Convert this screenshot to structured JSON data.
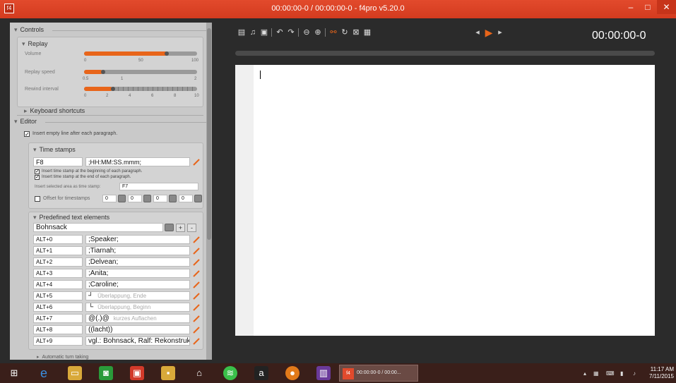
{
  "window": {
    "title": "00:00:00-0 / 00:00:00-0 - f4pro v5.20.0",
    "app_icon": "f4-icon",
    "controls": {
      "minimize": "–",
      "maximize": "□",
      "close": "✕"
    }
  },
  "colors": {
    "accent": "#e8651a",
    "titlebar": "#d43b1f",
    "panel": "#c9c9c9"
  },
  "controls_section": {
    "title": "Controls",
    "replay": {
      "title": "Replay",
      "volume_label": "Volume",
      "volume_ticks": [
        "0",
        "50",
        "100"
      ],
      "volume_value": 75,
      "speed_label": "Replay speed",
      "speed_ticks": [
        "0.5",
        "1",
        "2"
      ],
      "speed_value": 0.75,
      "rewind_label": "Rewind interval",
      "rewind_ticks": [
        "0",
        "2",
        "4",
        "6",
        "8",
        "10"
      ],
      "rewind_value": 3
    },
    "keyboard_shortcuts": "Keyboard shortcuts"
  },
  "editor_section": {
    "title": "Editor",
    "insert_empty_line": "Insert empty line after each paragraph.",
    "timestamps": {
      "title": "Time stamps",
      "key": "F8",
      "format": ";HH:MM:SS.mmm;",
      "opt_begin": "Insert time stamp at the beginning of each paragraph.",
      "opt_end": "Insert time stamp at the end of each paragraph.",
      "selected_area_label": "Insert selected area as time stamp:",
      "selected_area_key": "F7",
      "offset_label": "Offset for timestamps",
      "offset_values": [
        "0",
        "0",
        "0",
        "0"
      ]
    },
    "predefined": {
      "title": "Predefined text elements",
      "preset": "Bohnsack",
      "add": "+",
      "remove": "-",
      "rows": [
        {
          "key": "ALT+0",
          "text": ";Speaker;"
        },
        {
          "key": "ALT+1",
          "text": ";Tiarnah;"
        },
        {
          "key": "ALT+2",
          "text": ";Delvean;"
        },
        {
          "key": "ALT+3",
          "text": ";Anita;"
        },
        {
          "key": "ALT+4",
          "text": ";Caroline;"
        },
        {
          "key": "ALT+5",
          "text": "┘",
          "hint": "Überlappung, Ende"
        },
        {
          "key": "ALT+6",
          "text": "└",
          "hint": "Überlappung, Beginn"
        },
        {
          "key": "ALT+7",
          "text": "@(.)@",
          "hint": "kurzes Auflachen"
        },
        {
          "key": "ALT+8",
          "text": "((lacht))"
        },
        {
          "key": "ALT+9",
          "text": "vgl.: Bohnsack, Ralf: Rekonstrukti"
        }
      ]
    },
    "auto_turn": "Automatic turn taking"
  },
  "toolbar": {
    "icons": [
      "save-icon",
      "music-icon",
      "disk-icon",
      "undo-icon",
      "redo-icon",
      "zoom-out-icon",
      "zoom-in-icon",
      "link-icon",
      "refresh-icon",
      "close-icon",
      "calendar-icon"
    ],
    "time_display": "00:00:00-0"
  },
  "taskbar": {
    "active_task_label": "00:00:00-0 / 00:00...",
    "clock_time": "11:17 AM",
    "clock_date": "7/11/2015"
  }
}
